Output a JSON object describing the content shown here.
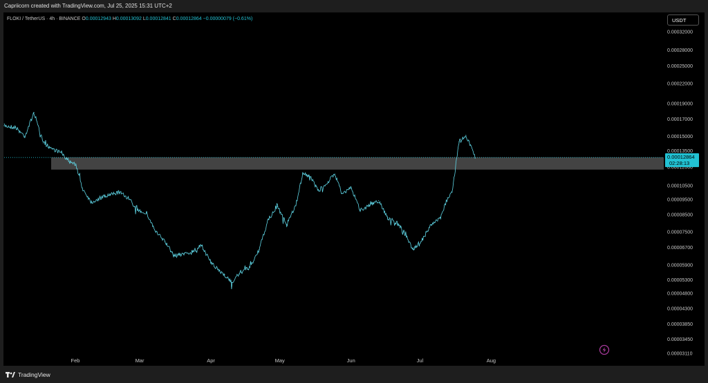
{
  "header": {
    "credit": "Capriicorn created with TradingView.com, Jul 25, 2025 15:31 UTC+2"
  },
  "legend": {
    "symbol": "FLOKI / TetherUS · 4h · BINANCE",
    "o_label": "O",
    "o": "0.00012943",
    "h_label": "H",
    "h": "0.00013092",
    "l_label": "L",
    "l": "0.00012841",
    "c_label": "C",
    "c": "0.00012864",
    "change": "−0.00000079 (−0.61%)"
  },
  "currency_button": "USDT",
  "price_badge": {
    "price": "0.00012864",
    "countdown": "02:28:13"
  },
  "footer": {
    "brand": "TradingView"
  },
  "colors": {
    "line": "#5fd6e6",
    "accent": "#22c2d4",
    "zone": "#5a5a5a",
    "bolt": "#a83a9c"
  },
  "chart_data": {
    "type": "line",
    "title": "",
    "y_scale": "log",
    "y_ticks": [
      "0.00032000",
      "0.00028000",
      "0.00025000",
      "0.00022000",
      "0.00019000",
      "0.00017000",
      "0.00015000",
      "0.00013500",
      "0.00012000",
      "0.00010500",
      "0.00009500",
      "0.00008500",
      "0.00007500",
      "0.00006700",
      "0.00005900",
      "0.00005300",
      "0.00004800",
      "0.00004300",
      "0.00003850",
      "0.00003450",
      "0.00003110"
    ],
    "x_ticks": [
      "Feb",
      "Mar",
      "Apr",
      "May",
      "Jun",
      "Jul",
      "Aug"
    ],
    "x": [
      "2025-01-01",
      "2025-01-06",
      "2025-01-10",
      "2025-01-14",
      "2025-01-18",
      "2025-01-22",
      "2025-01-26",
      "2025-01-29",
      "2025-02-01",
      "2025-02-04",
      "2025-02-08",
      "2025-02-12",
      "2025-02-16",
      "2025-02-20",
      "2025-02-24",
      "2025-02-28",
      "2025-03-04",
      "2025-03-08",
      "2025-03-12",
      "2025-03-16",
      "2025-03-20",
      "2025-03-24",
      "2025-03-28",
      "2025-04-01",
      "2025-04-04",
      "2025-04-07",
      "2025-04-10",
      "2025-04-14",
      "2025-04-18",
      "2025-04-22",
      "2025-04-26",
      "2025-04-30",
      "2025-05-04",
      "2025-05-08",
      "2025-05-11",
      "2025-05-14",
      "2025-05-18",
      "2025-05-22",
      "2025-05-25",
      "2025-05-28",
      "2025-06-01",
      "2025-06-05",
      "2025-06-09",
      "2025-06-13",
      "2025-06-17",
      "2025-06-21",
      "2025-06-24",
      "2025-06-28",
      "2025-07-02",
      "2025-07-06",
      "2025-07-10",
      "2025-07-13",
      "2025-07-15",
      "2025-07-18",
      "2025-07-21",
      "2025-07-23",
      "2025-07-25"
    ],
    "y": [
      0.000162,
      0.00016,
      0.00015,
      0.000178,
      0.000143,
      0.000137,
      0.000133,
      0.000125,
      0.000123,
      0.000103,
      9.3e-05,
      9.6e-05,
      9.8e-05,
      0.0001,
      9.6e-05,
      8.8e-05,
      8.6e-05,
      7.5e-05,
      7e-05,
      6.3e-05,
      6.4e-05,
      6.5e-05,
      6.8e-05,
      6e-05,
      5.7e-05,
      5.5e-05,
      5.2e-05,
      5.6e-05,
      5.8e-05,
      6.6e-05,
      8.2e-05,
      9e-05,
      7.9e-05,
      9.1e-05,
      0.000115,
      0.000112,
      0.000101,
      0.000108,
      0.000114,
      9.9e-05,
      0.000103,
      8.8e-05,
      9.1e-05,
      9.4e-05,
      8.3e-05,
      8e-05,
      7.5e-05,
      6.6e-05,
      7.1e-05,
      7.9e-05,
      8.3e-05,
      9.6e-05,
      0.0001,
      0.000144,
      0.000151,
      0.000141,
      0.000128
    ],
    "zone": {
      "low": 0.0001178,
      "high": 0.0001287
    },
    "current_price": 0.00012864
  }
}
